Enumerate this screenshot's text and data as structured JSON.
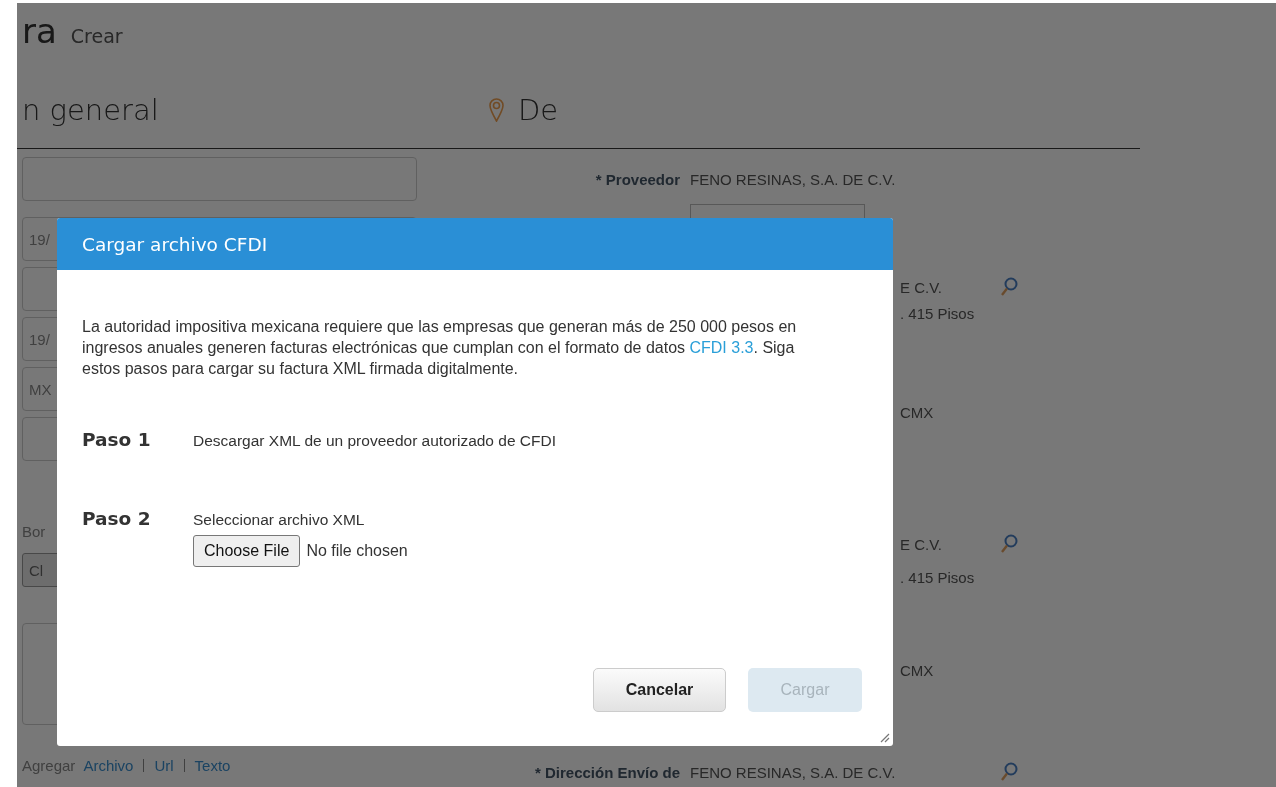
{
  "page": {
    "title": "ra",
    "subtitle": "Crear",
    "left_heading": "n general",
    "right_heading": "De",
    "left_fields": [
      {
        "kind": "field"
      },
      {
        "kind": "field",
        "value": "19/"
      },
      {
        "kind": "field"
      },
      {
        "kind": "field",
        "value": "19/"
      },
      {
        "kind": "field",
        "value": "MX"
      },
      {
        "kind": "field"
      },
      {
        "kind": "label",
        "value": "Bor"
      },
      {
        "kind": "button",
        "value": "Cl"
      },
      {
        "kind": "textarea"
      }
    ],
    "attach": {
      "label": "Agregar",
      "links": [
        "Archivo",
        "Url",
        "Texto"
      ]
    },
    "right_rows": [
      {
        "kind": "text",
        "label": "* Proveedor",
        "value": "FENO RESINAS, S.A. DE C.V.",
        "search": false
      },
      {
        "kind": "field",
        "label": "",
        "value": "",
        "search": false
      },
      {
        "kind": "tail",
        "label": "",
        "value": "E C.V.",
        "search": true
      },
      {
        "kind": "tail",
        "label": "",
        "value": ". 415 Pisos",
        "search": false
      },
      {
        "kind": "tail",
        "label": "",
        "value": "CMX",
        "search": false
      },
      {
        "kind": "tail",
        "label": "",
        "value": "E C.V.",
        "search": true
      },
      {
        "kind": "tail",
        "label": "",
        "value": ". 415 Pisos",
        "search": false
      },
      {
        "kind": "tail",
        "label": "",
        "value": "CMX",
        "search": false
      },
      {
        "kind": "text",
        "label": "* Dirección Envío de",
        "value": "FENO RESINAS, S.A. DE C.V.",
        "search": true
      }
    ]
  },
  "dialog": {
    "title": "Cargar archivo CFDI",
    "intro_before": "La autoridad impositiva mexicana requiere que las empresas que generan más de 250 000 pesos en ingresos anuales generen facturas electrónicas que cumplan con el formato de datos",
    "intro_link": "CFDI 3.3",
    "intro_after": ". Siga estos pasos para cargar su factura XML firmada digitalmente.",
    "steps": [
      {
        "label": "Paso 1",
        "text": "Descargar XML de un proveedor autorizado de CFDI"
      },
      {
        "label": "Paso 2",
        "text": "Seleccionar archivo XML",
        "file_button": "Choose File",
        "file_status": "No file chosen"
      }
    ],
    "buttons": [
      {
        "label": "Cancelar",
        "disabled": false
      },
      {
        "label": "Cargar",
        "disabled": true
      }
    ]
  }
}
